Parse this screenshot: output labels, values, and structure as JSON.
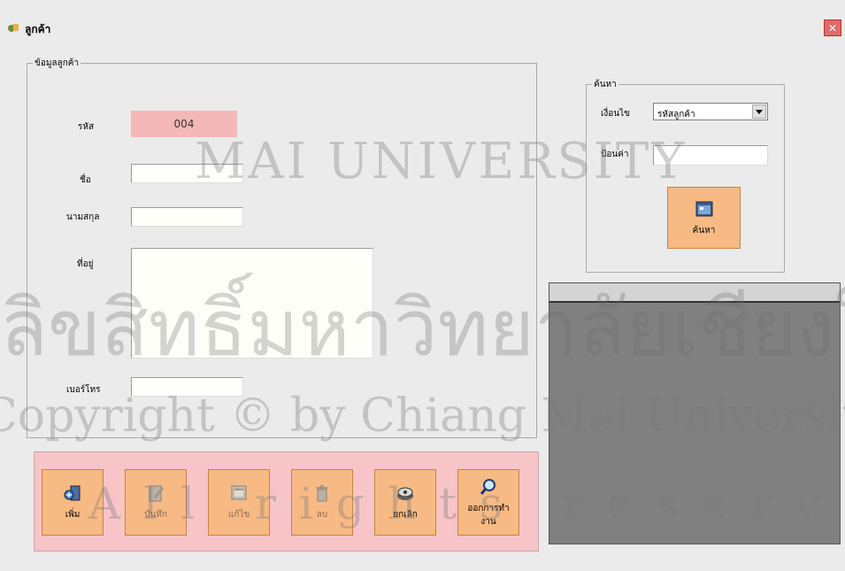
{
  "window": {
    "title": "ลูกค้า",
    "close_glyph": "✕"
  },
  "customer_group": {
    "legend": "ข้อมูลลูกค้า",
    "fields": {
      "id_label": "รหัส",
      "id_value": "004",
      "first_name_label": "ชื่อ",
      "first_name_value": "",
      "last_name_label": "นามสกุล",
      "last_name_value": "",
      "address_label": "ที่อยู่",
      "address_value": "",
      "phone_label": "เบอร์โทร",
      "phone_value": ""
    }
  },
  "search_group": {
    "legend": "ค้นหา",
    "condition_label": "เงื่อนไข",
    "condition_value": "รหัสลูกค้า",
    "keyword_label": "ป้อนค่า",
    "keyword_value": "",
    "search_button": "ค้นหา"
  },
  "toolbar": {
    "add": "เพิ่ม",
    "save": "บันทึก",
    "edit": "แก้ไข",
    "delete": "ลบ",
    "cancel": "ยกเลิก",
    "exit_line1": "ออกการทำ",
    "exit_line2": "งาน"
  },
  "watermark": {
    "arc_text": "MAI UNIVERSITY",
    "thai_text": "ลิขสิทธิ์มหาวิทยาลัยเชียงใหม่",
    "copyright": "Copyright © by Chiang Mai University",
    "rights": "All rights reserved"
  },
  "colors": {
    "accent_button": "#f7ba84",
    "id_highlight": "#f5b8b8",
    "toolbar_bg": "#f7c5c8",
    "grid_bg": "#808080"
  }
}
